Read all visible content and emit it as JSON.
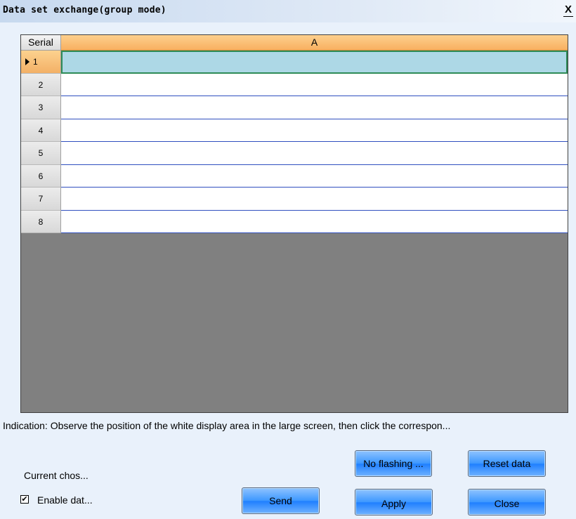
{
  "window": {
    "title": "Data set exchange(group mode)",
    "close_glyph": "X"
  },
  "grid": {
    "columns": [
      "Serial",
      "A"
    ],
    "rows": [
      {
        "serial": "1",
        "value": ""
      },
      {
        "serial": "2",
        "value": ""
      },
      {
        "serial": "3",
        "value": ""
      },
      {
        "serial": "4",
        "value": ""
      },
      {
        "serial": "5",
        "value": ""
      },
      {
        "serial": "6",
        "value": ""
      },
      {
        "serial": "7",
        "value": ""
      },
      {
        "serial": "8",
        "value": ""
      }
    ],
    "selected_row": "1"
  },
  "indication": "Indication: Observe the position of the white display area in the large screen, then click the correspon...",
  "footer": {
    "current_choice_label": "Current chos...",
    "enable_label": "Enable dat...",
    "enable_checked": true,
    "buttons": {
      "no_flashing": "No flashing ...",
      "reset_data": "Reset data",
      "send": "Send",
      "apply": "Apply",
      "close": "Close"
    }
  },
  "colors": {
    "header_accent": "#f8b060",
    "selection": "#add8e6",
    "button": "#3c97ff"
  }
}
